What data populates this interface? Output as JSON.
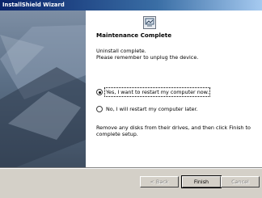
{
  "window": {
    "title": "InstallShield Wizard"
  },
  "main": {
    "heading": "Maintenance Complete",
    "text_line1": "Uninstall complete.",
    "text_line2": "Please remember to unplug the device.",
    "radio_restart_now": "Yes, I want to restart my computer now.",
    "radio_restart_later": "No, I will restart my computer later.",
    "footer_text": "Remove any disks from their drives, and then click Finish to complete setup.",
    "selected_option": "restart_now"
  },
  "buttons": {
    "back": "< Back",
    "finish": "Finish",
    "cancel": "Cancel"
  },
  "colors": {
    "title_bar": "#0a246a",
    "dialog_bg": "#d4d0c8",
    "panel_bg": "#ffffff"
  }
}
